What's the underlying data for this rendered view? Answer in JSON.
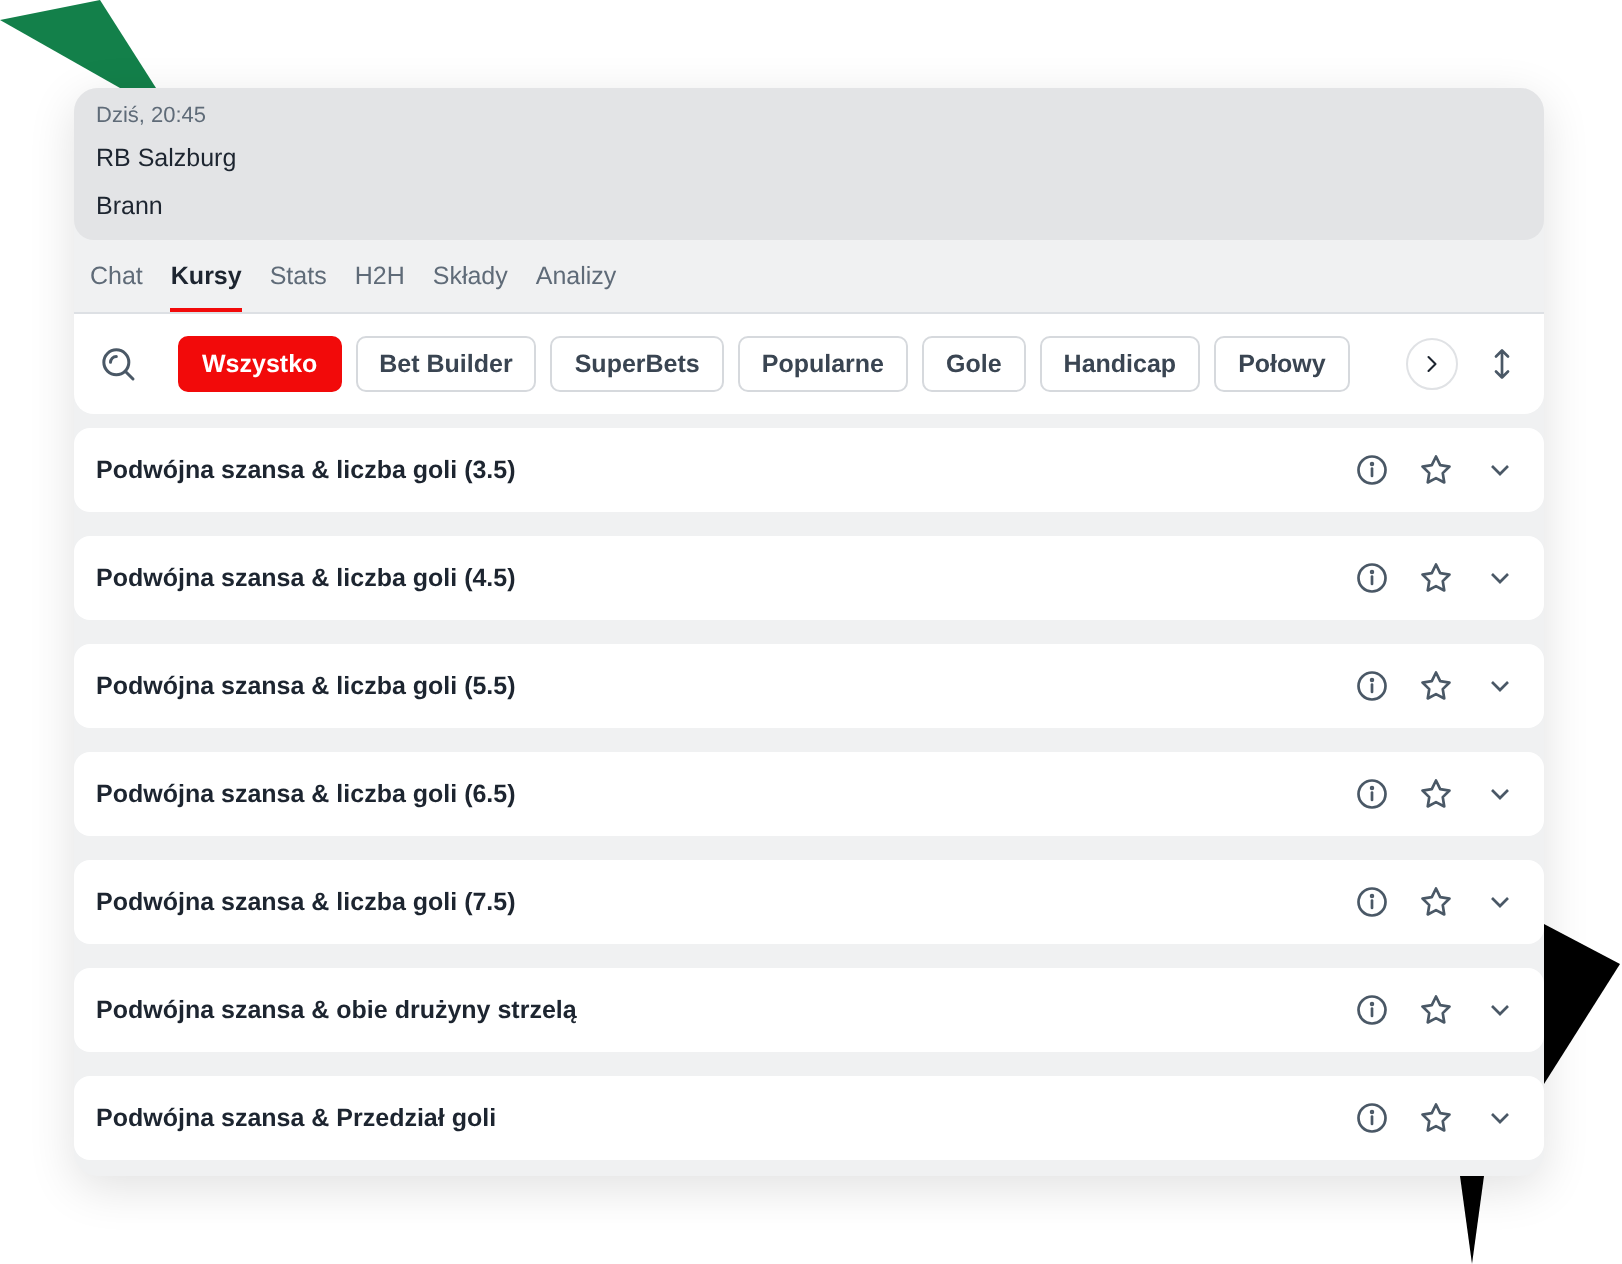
{
  "match": {
    "time": "Dziś, 20:45",
    "home": "RB Salzburg",
    "away": "Brann"
  },
  "tabs": [
    {
      "label": "Chat",
      "selected": false
    },
    {
      "label": "Kursy",
      "selected": true
    },
    {
      "label": "Stats",
      "selected": false
    },
    {
      "label": "H2H",
      "selected": false
    },
    {
      "label": "Składy",
      "selected": false
    },
    {
      "label": "Analizy",
      "selected": false
    }
  ],
  "filters": [
    {
      "label": "Wszystko",
      "selected": true
    },
    {
      "label": "Bet Builder",
      "selected": false
    },
    {
      "label": "SuperBets",
      "selected": false
    },
    {
      "label": "Popularne",
      "selected": false
    },
    {
      "label": "Gole",
      "selected": false
    },
    {
      "label": "Handicap",
      "selected": false
    },
    {
      "label": "Połowy",
      "selected": false
    }
  ],
  "markets": [
    {
      "name": "Podwójna szansa & liczba goli (3.5)",
      "expanded": false
    },
    {
      "name": "Podwójna szansa & liczba goli (4.5)",
      "expanded": false
    },
    {
      "name": "Podwójna szansa & liczba goli (5.5)",
      "expanded": false
    },
    {
      "name": "Podwójna szansa & liczba goli (6.5)",
      "expanded": false
    },
    {
      "name": "Podwójna szansa & liczba goli (7.5)",
      "expanded": false
    },
    {
      "name": "Podwójna szansa & obie drużyny strzelą",
      "expanded": false
    },
    {
      "name": "Podwójna szansa & Przedział goli",
      "expanded": false
    }
  ]
}
